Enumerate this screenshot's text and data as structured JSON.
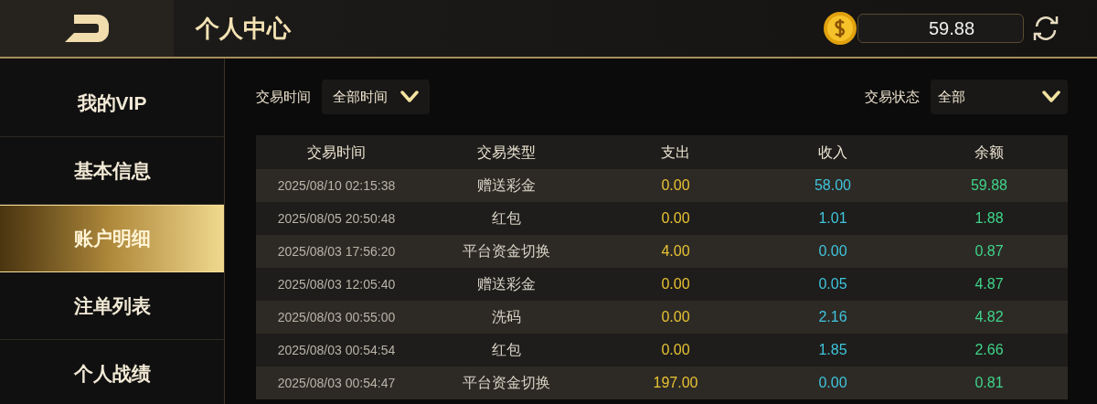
{
  "header": {
    "title": "个人中心",
    "balance": "59.88"
  },
  "sidebar": {
    "items": [
      {
        "label": "我的VIP",
        "selected": false
      },
      {
        "label": "基本信息",
        "selected": false
      },
      {
        "label": "账户明细",
        "selected": true
      },
      {
        "label": "注单列表",
        "selected": false
      },
      {
        "label": "个人战绩",
        "selected": false
      }
    ]
  },
  "filters": [
    {
      "label": "交易时间",
      "value": "全部时间"
    },
    {
      "label": "交易状态",
      "value": "全部"
    }
  ],
  "table": {
    "columns": [
      "交易时间",
      "交易类型",
      "支出",
      "收入",
      "余额"
    ],
    "rows": [
      [
        "2025/08/10 02:15:38",
        "赠送彩金",
        "0.00",
        "58.00",
        "59.88"
      ],
      [
        "2025/08/05 20:50:48",
        "红包",
        "0.00",
        "1.01",
        "1.88"
      ],
      [
        "2025/08/03 17:56:20",
        "平台资金切换",
        "4.00",
        "0.00",
        "0.87"
      ],
      [
        "2025/08/03 12:05:40",
        "赠送彩金",
        "0.00",
        "0.05",
        "4.87"
      ],
      [
        "2025/08/03 00:55:00",
        "洗码",
        "0.00",
        "2.16",
        "4.82"
      ],
      [
        "2025/08/03 00:54:54",
        "红包",
        "0.00",
        "1.85",
        "2.66"
      ],
      [
        "2025/08/03 00:54:47",
        "平台资金切换",
        "197.00",
        "0.00",
        "0.81"
      ]
    ]
  }
}
